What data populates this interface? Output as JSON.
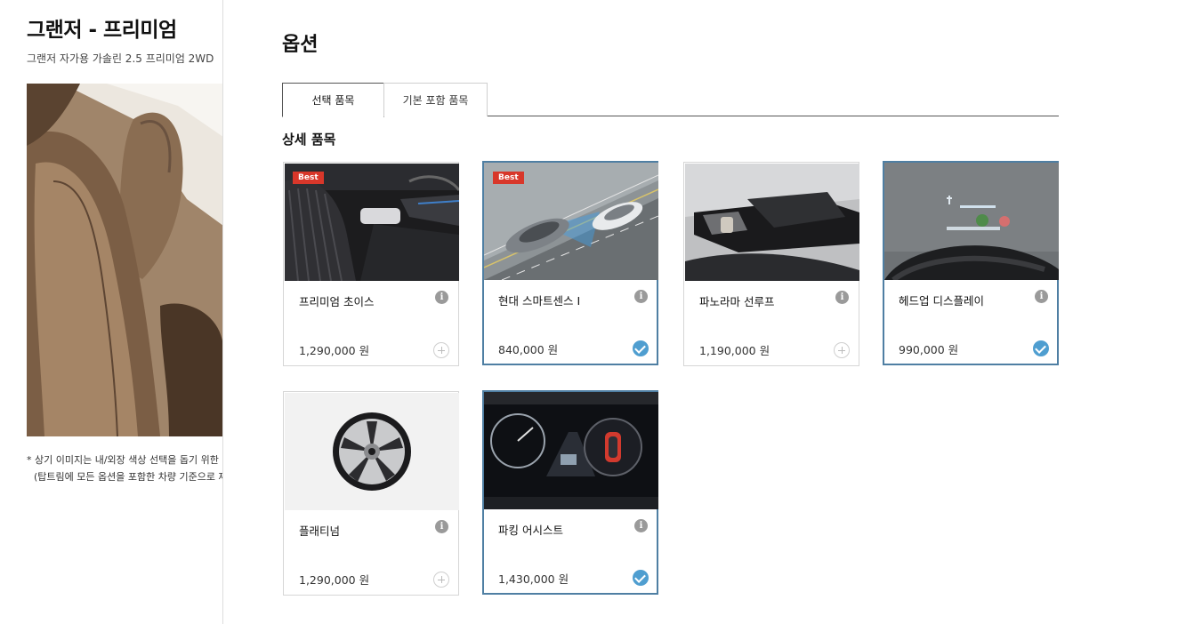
{
  "vehicle": {
    "title": "그랜저 - 프리미엄",
    "subtitle": "그랜저 자가용 가솔린 2.5 프리미엄 2WD",
    "disclaimer_line1": "* 상기 이미지는 내/외장 색상 선택을 돕기 위한 참고",
    "disclaimer_line2": "(탑트림에 모든 옵션을 포함한 차량 기준으로 제작"
  },
  "options": {
    "heading": "옵션",
    "tabs": [
      {
        "label": "선택 품목",
        "active": true
      },
      {
        "label": "기본 포함 품목",
        "active": false
      }
    ],
    "section_title": "상세 품목",
    "items": [
      {
        "name": "프리미엄 초이스",
        "price": "1,290,000 원",
        "badge": "Best",
        "selected": false,
        "image": "interior-seats"
      },
      {
        "name": "현대 스마트센스 I",
        "price": "840,000 원",
        "badge": "Best",
        "selected": true,
        "image": "road-driving"
      },
      {
        "name": "파노라마 선루프",
        "price": "1,190,000 원",
        "badge": "",
        "selected": false,
        "image": "panorama-sunroof"
      },
      {
        "name": "헤드업 디스플레이",
        "price": "990,000 원",
        "badge": "",
        "selected": true,
        "image": "head-up-display"
      },
      {
        "name": "플래티넘",
        "price": "1,290,000 원",
        "badge": "",
        "selected": false,
        "image": "alloy-wheel"
      },
      {
        "name": "파킹 어시스트",
        "price": "1,430,000 원",
        "badge": "",
        "selected": true,
        "image": "parking-cluster"
      }
    ]
  },
  "colors": {
    "selected_border": "#4f7fa3",
    "check": "#4f9ed0",
    "badge": "#d8372a"
  }
}
